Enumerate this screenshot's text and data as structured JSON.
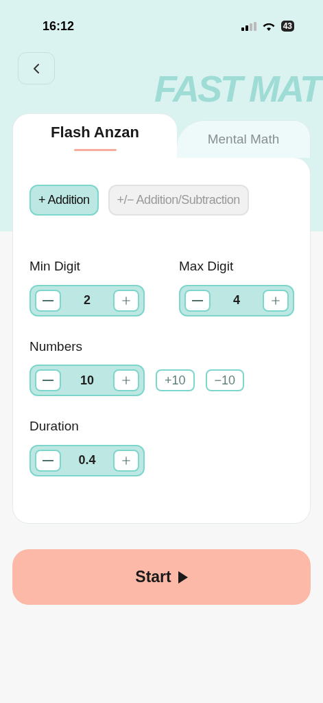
{
  "status_bar": {
    "time": "16:12",
    "battery": "43"
  },
  "header": {
    "wordmark": "FAST MAT"
  },
  "tabs": [
    {
      "label": "Flash Anzan",
      "selected": true
    },
    {
      "label": "Mental Math",
      "selected": false
    }
  ],
  "modes": [
    {
      "label": "+ Addition",
      "selected": true
    },
    {
      "label": "+/− Addition/Subtraction",
      "selected": false
    }
  ],
  "settings": [
    {
      "fields": [
        {
          "label": "Min Digit",
          "value": "2"
        },
        {
          "label": "Max Digit",
          "value": "4"
        }
      ]
    },
    {
      "fields": [
        {
          "label": "Numbers",
          "value": "10"
        }
      ],
      "quick_buttons": [
        "+10",
        "−10"
      ]
    },
    {
      "fields": [
        {
          "label": "Duration",
          "value": "0.4"
        }
      ]
    }
  ],
  "start_button": {
    "label": "Start"
  }
}
